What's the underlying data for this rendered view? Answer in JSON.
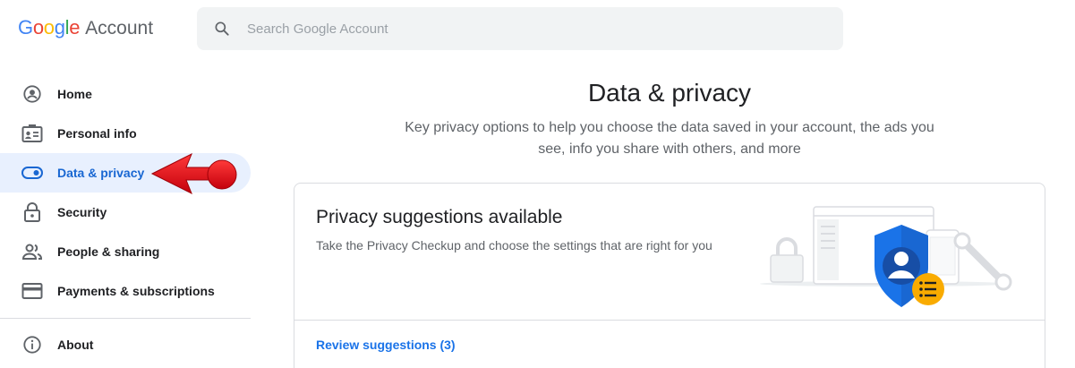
{
  "header": {
    "logo_google": "Google",
    "logo_account": "Account",
    "search_placeholder": "Search Google Account"
  },
  "nav": {
    "items": [
      {
        "label": "Home",
        "icon": "account-circle-icon"
      },
      {
        "label": "Personal info",
        "icon": "id-card-icon"
      },
      {
        "label": "Data & privacy",
        "icon": "toggle-icon",
        "active": true
      },
      {
        "label": "Security",
        "icon": "lock-icon"
      },
      {
        "label": "People & sharing",
        "icon": "people-icon"
      },
      {
        "label": "Payments & subscriptions",
        "icon": "credit-card-icon"
      }
    ],
    "about": {
      "label": "About",
      "icon": "info-icon"
    }
  },
  "main": {
    "title": "Data & privacy",
    "subtitle": "Key privacy options to help you choose the data saved in your account, the ads you see, info you share with others, and more"
  },
  "card": {
    "title": "Privacy suggestions available",
    "description": "Take the Privacy Checkup and choose the settings that are right for you",
    "link": "Review suggestions (3)"
  },
  "colors": {
    "active_bg": "#e8f0fe",
    "active_text": "#1967d2",
    "link": "#1a73e8",
    "arrow": "#e8101c",
    "shield": "#1a73e8",
    "badge": "#f9ab00"
  }
}
